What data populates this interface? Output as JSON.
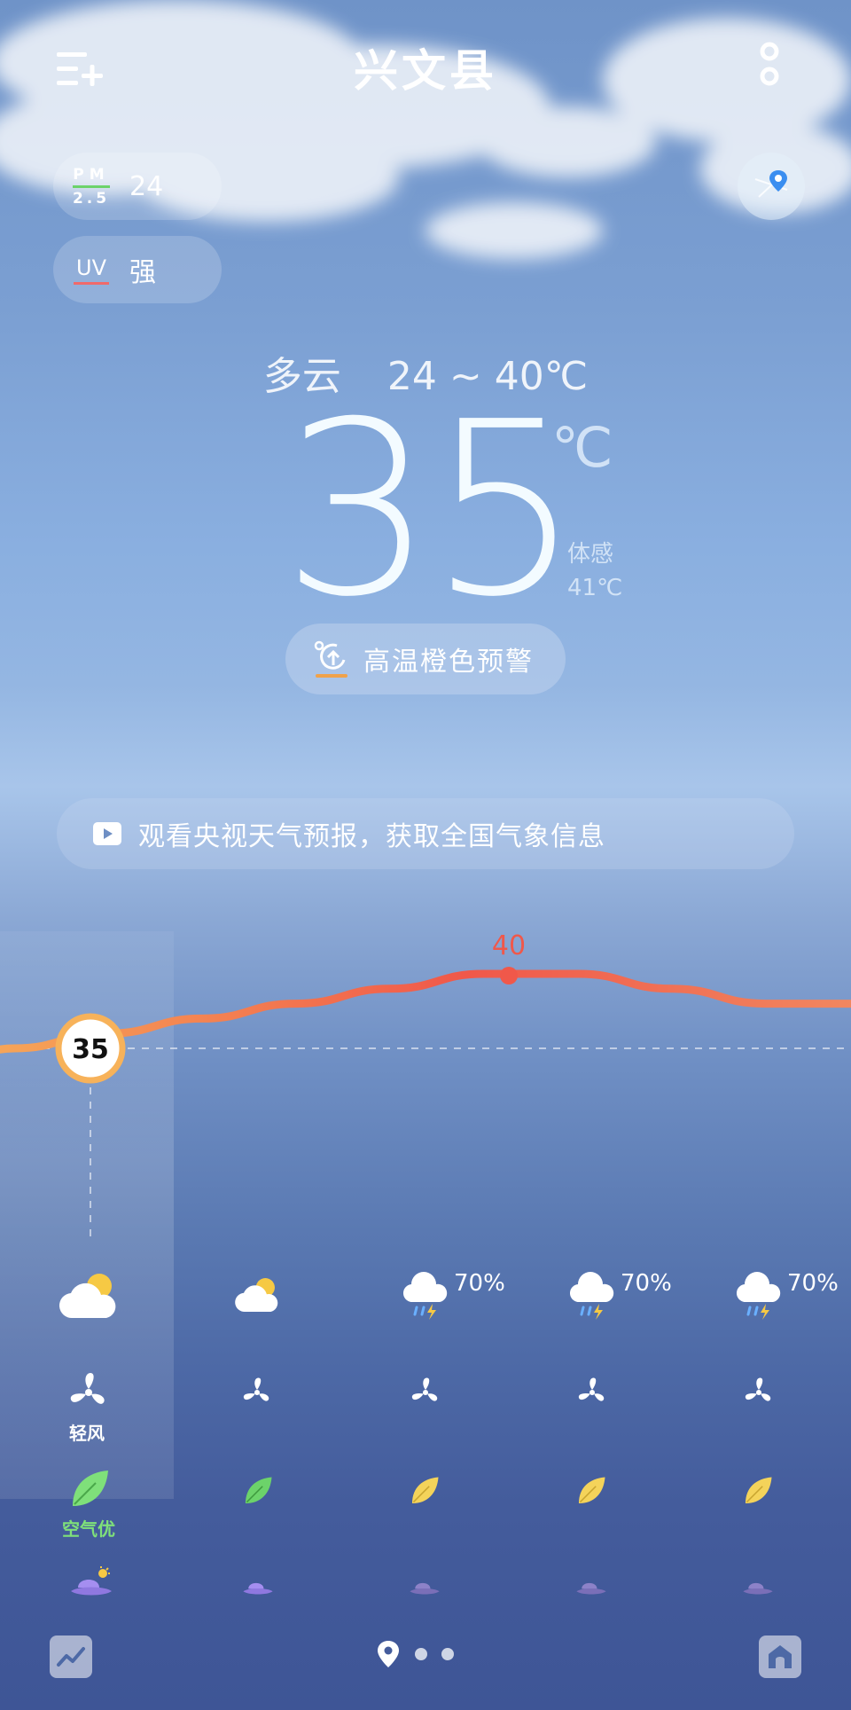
{
  "header": {
    "title": "兴文县",
    "add_city_icon": "add-city-icon",
    "menu_icon": "more-vertical-icon"
  },
  "chips": {
    "pm": {
      "label_top": "PM",
      "label_bottom": "2.5",
      "value": "24"
    },
    "uv": {
      "label": "UV",
      "value": "强"
    }
  },
  "current": {
    "condition": "多云",
    "range": "24 ~ 40℃",
    "temperature": "35",
    "unit": "℃",
    "feels_label": "体感",
    "feels_value": "41℃"
  },
  "alert": {
    "text": "高温橙色预警",
    "color": "#f0a24a"
  },
  "banner": {
    "text": "观看央视天气预报，获取全国气象信息"
  },
  "chart_data": {
    "type": "line",
    "x": [
      0,
      1,
      2,
      3,
      4,
      5,
      6,
      7,
      8,
      9,
      10
    ],
    "values": [
      33,
      35,
      36,
      37,
      38,
      39,
      40,
      40,
      39,
      38,
      38
    ],
    "current_label": "35",
    "peak_label": "40",
    "colors": {
      "start": "#f7b25a",
      "peak": "#f0584a",
      "end": "#f08860"
    }
  },
  "hourly": [
    {
      "icon": "partly-cloudy-icon",
      "wind_label": "轻风",
      "air_label": "空气优",
      "air_color": "#7fe07a",
      "selected": true
    },
    {
      "icon": "partly-cloudy-icon",
      "air_color": "#6cd36a"
    },
    {
      "icon": "thunder-rain-icon",
      "precip": "70%",
      "air_color": "#f4d35a"
    },
    {
      "icon": "thunder-rain-icon",
      "precip": "70%",
      "air_color": "#f4d35a"
    },
    {
      "icon": "thunder-rain-icon",
      "precip": "70%",
      "air_color": "#f4d35a"
    }
  ],
  "footer": {
    "trend_icon": "trend-chart-icon",
    "home_icon": "home-icon",
    "pager_count": 3
  }
}
